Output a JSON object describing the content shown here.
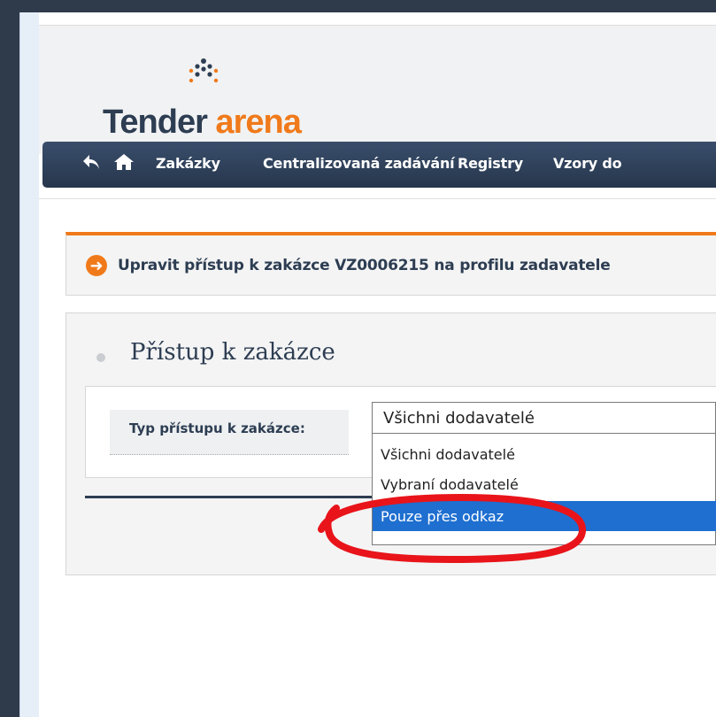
{
  "logo": {
    "word1": "Tender",
    "word2": " arena"
  },
  "nav": {
    "back_icon": "back-arrow-icon",
    "home_icon": "home-icon",
    "items": [
      "Zakázky",
      "Centralizovaná zadávání",
      "Registry",
      "Vzory do"
    ]
  },
  "info": {
    "icon": "arrow-right-circle-icon",
    "text": "Upravit přístup k zakázce VZ0006215 na profilu zadavatele"
  },
  "section": {
    "title": "Přístup k zakázce",
    "field_label": "Typ přístupu k zakázce:",
    "select_value": "Všichni dodavatelé",
    "options": [
      "Všichni dodavatelé",
      "Vybraní dodavatelé",
      "Pouze přes odkaz"
    ],
    "selected_index": 2
  },
  "colors": {
    "brand_dark": "#2d3d52",
    "brand_orange": "#f07a1a",
    "highlight": "#1e6fd0",
    "annotation": "#e8141a"
  }
}
